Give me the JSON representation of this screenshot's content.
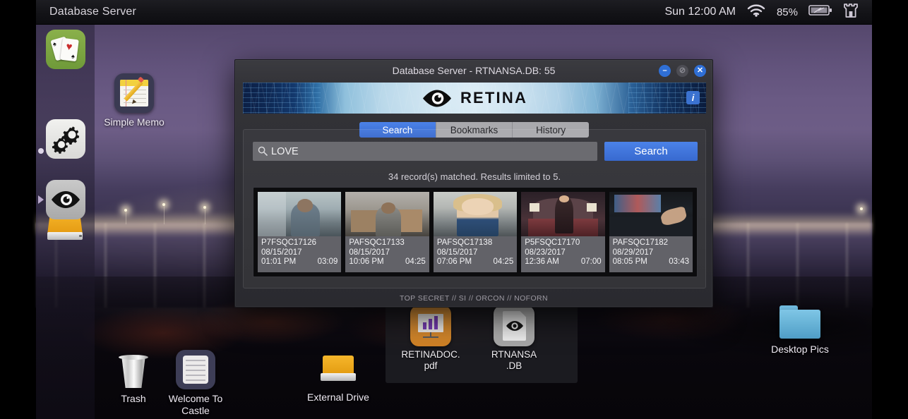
{
  "menubar": {
    "title": "Database Server",
    "clock": "Sun 12:00 AM",
    "battery_percent": "85%",
    "wifi_icon": "wifi-icon",
    "battery_icon": "battery-icon",
    "castle_icon": "castle-logo-icon"
  },
  "dock": {
    "items": [
      {
        "name": "solitaire",
        "icon": "playing-cards-icon"
      },
      {
        "name": "settings",
        "icon": "gears-icon"
      },
      {
        "name": "hard-drive",
        "icon": "hard-drive-icon"
      },
      {
        "name": "retina",
        "icon": "eye-icon"
      }
    ]
  },
  "desktop": {
    "icons": [
      {
        "label": "Simple Memo",
        "icon": "memo-notepad-icon"
      },
      {
        "label": "Trash",
        "icon": "trash-can-icon"
      },
      {
        "label": "Welcome To Castle",
        "icon": "notes-document-icon"
      },
      {
        "label": "External Drive",
        "icon": "external-drive-icon"
      },
      {
        "label": "Desktop Pics",
        "icon": "blue-folder-icon"
      }
    ],
    "files": [
      {
        "label": "RETINADOC.",
        "label2": "pdf",
        "icon": "pdf-presentation-icon"
      },
      {
        "label": "RTNANSA",
        "label2": ".DB",
        "icon": "eye-document-icon"
      }
    ]
  },
  "dialog": {
    "title": "Database Server - RTNANSA.DB: 55",
    "window_buttons": {
      "minimize": "–",
      "maximize": "⊘",
      "close": "✕"
    },
    "banner": {
      "brand": "RETINA",
      "logo_icon": "eye-logo-icon",
      "info_label": "i"
    },
    "tabs": [
      {
        "label": "Search",
        "active": true
      },
      {
        "label": "Bookmarks",
        "active": false
      },
      {
        "label": "History",
        "active": false
      }
    ],
    "search": {
      "value": "LOVE",
      "placeholder": "Search",
      "button_label": "Search",
      "icon": "magnifier-icon"
    },
    "match_text": "34 record(s) matched. Results limited to 5.",
    "results": [
      {
        "id": "P7FSQC17126",
        "date": "08/15/2017",
        "time": "01:01 PM",
        "duration": "03:09"
      },
      {
        "id": "PAFSQC17133",
        "date": "08/15/2017",
        "time": "10:06 PM",
        "duration": "04:25"
      },
      {
        "id": "PAFSQC17138",
        "date": "08/15/2017",
        "time": "07:06 PM",
        "duration": "04:25"
      },
      {
        "id": "P5FSQC17170",
        "date": "08/23/2017",
        "time": "12:36 AM",
        "duration": "07:00"
      },
      {
        "id": "PAFSQC17182",
        "date": "08/29/2017",
        "time": "08:05 PM",
        "duration": "03:43"
      }
    ],
    "classification": "TOP SECRET // SI // ORCON // NOFORN"
  },
  "colors": {
    "accent_blue": "#3869cf",
    "tab_active": "#4b82e8",
    "drive_orange": "#f0a81c",
    "folder_blue": "#5fb0d8"
  }
}
